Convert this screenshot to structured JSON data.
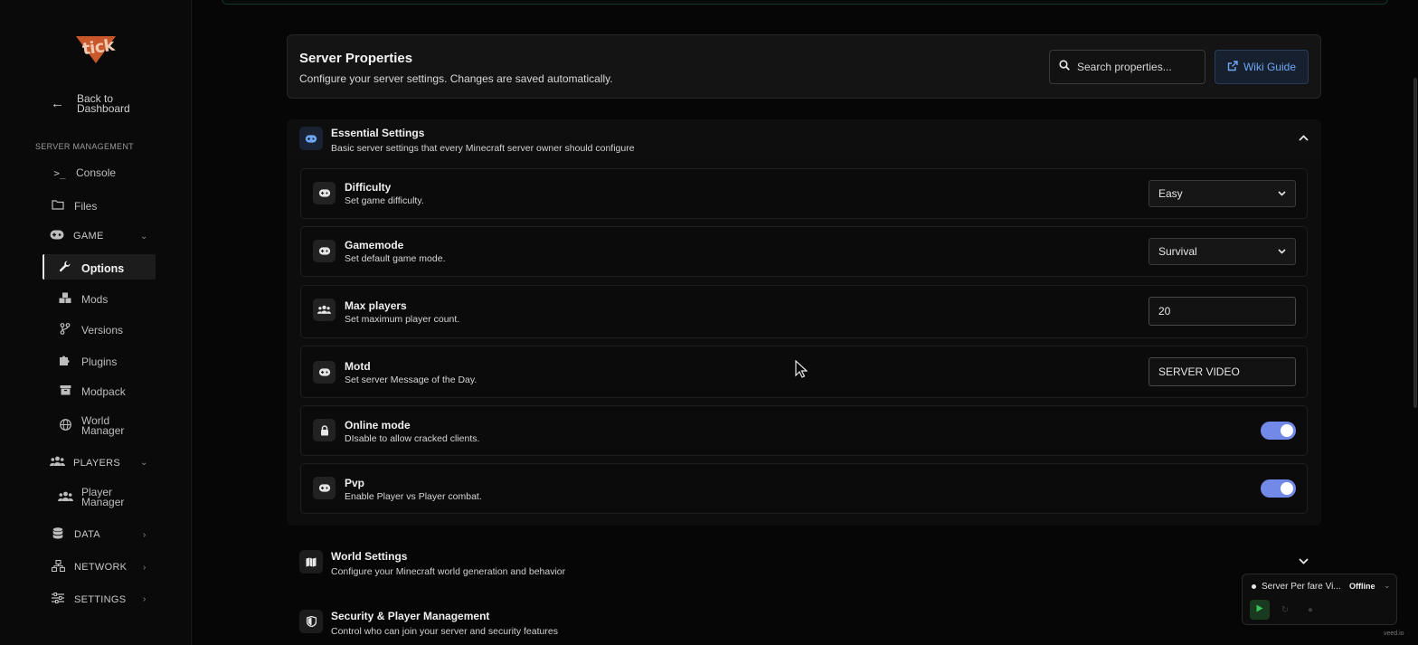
{
  "sidebar": {
    "logo_text": "tick",
    "back_label": "Back to Dashboard",
    "section_label": "SERVER MANAGEMENT",
    "items": [
      {
        "label": "Console",
        "icon": "terminal-icon"
      },
      {
        "label": "Files",
        "icon": "folder-icon"
      },
      {
        "label": "GAME",
        "icon": "gamepad-icon",
        "group": true,
        "expanded": true
      },
      {
        "label": "Options",
        "icon": "wrench-icon",
        "active": true
      },
      {
        "label": "Mods",
        "icon": "cubes-icon"
      },
      {
        "label": "Versions",
        "icon": "branch-icon"
      },
      {
        "label": "Plugins",
        "icon": "puzzle-icon"
      },
      {
        "label": "Modpack",
        "icon": "box-icon"
      },
      {
        "label": "World Manager",
        "icon": "globe-icon"
      },
      {
        "label": "PLAYERS",
        "icon": "users-icon",
        "group": true,
        "expanded": true
      },
      {
        "label": "Player Manager",
        "icon": "users-icon"
      },
      {
        "label": "DATA",
        "icon": "database-icon",
        "group": true
      },
      {
        "label": "NETWORK",
        "icon": "network-icon",
        "group": true
      },
      {
        "label": "SETTINGS",
        "icon": "sliders-icon",
        "group": true
      }
    ]
  },
  "header": {
    "title": "Server Properties",
    "subtitle": "Configure your server settings. Changes are saved automatically.",
    "search_placeholder": "Search properties...",
    "wiki_label": "Wiki Guide"
  },
  "sections": {
    "essential": {
      "title": "Essential Settings",
      "subtitle": "Basic server settings that every Minecraft server owner should configure",
      "expanded": true
    },
    "world": {
      "title": "World Settings",
      "subtitle": "Configure your Minecraft world generation and behavior",
      "expanded": false
    },
    "security": {
      "title": "Security & Player Management",
      "subtitle": "Control who can join your server and security features"
    }
  },
  "settings": {
    "difficulty": {
      "title": "Difficulty",
      "desc": "Set game difficulty.",
      "value": "Easy"
    },
    "gamemode": {
      "title": "Gamemode",
      "desc": "Set default game mode.",
      "value": "Survival"
    },
    "max_players": {
      "title": "Max players",
      "desc": "Set maximum player count.",
      "value": "20"
    },
    "motd": {
      "title": "Motd",
      "desc": "Set server Message of the Day.",
      "value": "SERVER VIDEO"
    },
    "online_mode": {
      "title": "Online mode",
      "desc": "DIsable to allow cracked clients.",
      "enabled": true
    },
    "pvp": {
      "title": "Pvp",
      "desc": "Enable Player vs Player combat.",
      "enabled": true
    }
  },
  "server_widget": {
    "name": "Server Per fare Vi...",
    "status": "Offline"
  },
  "watermark": "veed.io",
  "colors": {
    "accent": "#7389e8",
    "link": "#6ea8f5",
    "play": "#37c45a",
    "logo": "#c8572c"
  }
}
